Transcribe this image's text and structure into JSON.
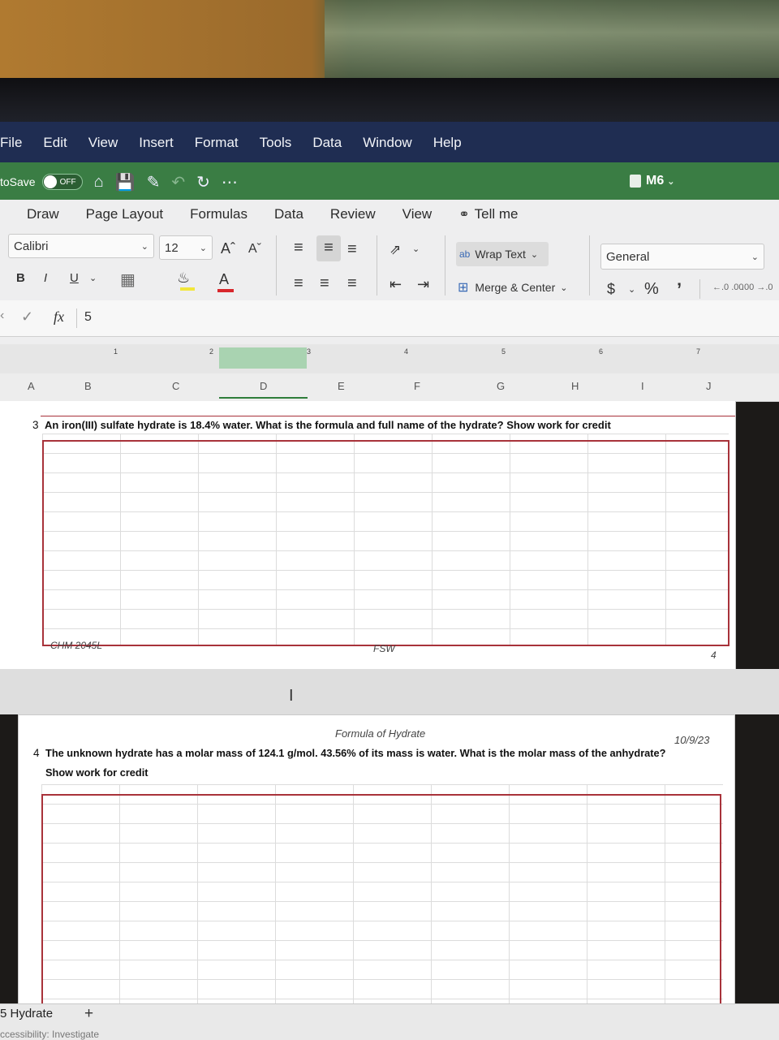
{
  "menubar": {
    "items": [
      "File",
      "Edit",
      "View",
      "Insert",
      "Format",
      "Tools",
      "Data",
      "Window",
      "Help"
    ]
  },
  "qat": {
    "autosave_label": "toSave",
    "toggle_state": "OFF",
    "file_name": "M6"
  },
  "ribbon": {
    "tabs": [
      "Draw",
      "Page Layout",
      "Formulas",
      "Data",
      "Review",
      "View"
    ],
    "tell_me": "Tell me",
    "font_name": "Calibri",
    "font_size": "12",
    "wrap_text": "Wrap Text",
    "merge_center": "Merge & Center",
    "number_format": "General",
    "bold": "B",
    "italic": "I",
    "underline": "U",
    "grow_font": "Aˆ",
    "shrink_font": "Aˇ",
    "font_color": "A",
    "currency": "$",
    "percent": "%",
    "comma": "9",
    "inc_decimal": "←.0 .00",
    "dec_decimal": ".00 →.0"
  },
  "formula_bar": {
    "fx": "fx",
    "value": "5"
  },
  "ruler_marks": [
    "1",
    "2",
    "3",
    "4",
    "5",
    "6",
    "7"
  ],
  "columns": [
    "A",
    "B",
    "C",
    "D",
    "E",
    "F",
    "G",
    "H",
    "I",
    "J"
  ],
  "page1": {
    "row_number": "3",
    "question": "An iron(III) sulfate hydrate is 18.4% water. What is the formula and full name of the hydrate? Show work for credit",
    "footer_left": "CHM 2045L",
    "footer_center": "FSW",
    "page_number": "4"
  },
  "page2": {
    "header_center": "Formula of Hydrate",
    "header_right": "10/9/23",
    "row_number": "4",
    "question": "The unknown hydrate has a molar mass of 124.1 g/mol.  43.56% of its mass is water. What is the molar mass of the anhydrate?",
    "question_line2": "Show work for credit"
  },
  "sheet": {
    "tab_name": "5 Hydrate",
    "add": "+",
    "status": "ccessibility: Investigate"
  },
  "colors": {
    "menubar": "#1f2d52",
    "qat": "#3a7d44",
    "accent_red": "#a8323a",
    "selected_col": "#a9d3b1"
  }
}
